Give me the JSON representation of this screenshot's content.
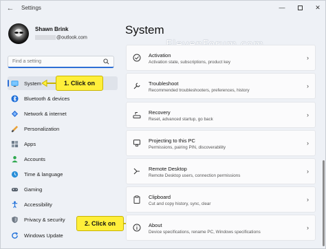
{
  "window": {
    "title": "Settings",
    "back_glyph": "←",
    "minimize_glyph": "—",
    "close_glyph": "✕"
  },
  "profile": {
    "name": "Shawn Brink",
    "email_visible": "@outlook.com"
  },
  "search": {
    "placeholder": "Find a setting"
  },
  "sidebar": {
    "items": [
      {
        "label": "System",
        "icon": "monitor-icon",
        "active": true
      },
      {
        "label": "Bluetooth & devices",
        "icon": "bluetooth-icon"
      },
      {
        "label": "Network & internet",
        "icon": "wifi-diamond-icon"
      },
      {
        "label": "Personalization",
        "icon": "brush-icon"
      },
      {
        "label": "Apps",
        "icon": "apps-icon"
      },
      {
        "label": "Accounts",
        "icon": "person-icon"
      },
      {
        "label": "Time & language",
        "icon": "globe-clock-icon"
      },
      {
        "label": "Gaming",
        "icon": "gamepad-icon"
      },
      {
        "label": "Accessibility",
        "icon": "accessibility-icon"
      },
      {
        "label": "Privacy & security",
        "icon": "shield-icon"
      },
      {
        "label": "Windows Update",
        "icon": "update-icon"
      }
    ]
  },
  "callouts": {
    "first": "1. Click on",
    "second": "2. Click on"
  },
  "main": {
    "title": "System",
    "watermark": "ElevenForum.com",
    "cards": [
      {
        "title": "Activation",
        "subtitle": "Activation state, subscriptions, product key",
        "icon": "check-circle-icon"
      },
      {
        "title": "Troubleshoot",
        "subtitle": "Recommended troubleshooters, preferences, history",
        "icon": "wrench-icon"
      },
      {
        "title": "Recovery",
        "subtitle": "Reset, advanced startup, go back",
        "icon": "recovery-drive-icon"
      },
      {
        "title": "Projecting to this PC",
        "subtitle": "Permissions, pairing PIN, discoverability",
        "icon": "projector-icon"
      },
      {
        "title": "Remote Desktop",
        "subtitle": "Remote Desktop users, connection permissions",
        "icon": "remote-desktop-icon"
      },
      {
        "title": "Clipboard",
        "subtitle": "Cut and copy history, sync, clear",
        "icon": "clipboard-icon"
      },
      {
        "title": "About",
        "subtitle": "Device specifications, rename PC, Windows specifications",
        "icon": "info-icon"
      }
    ],
    "chevron": "›"
  },
  "colors": {
    "accent": "#2c6ed5",
    "callout": "#ffef3a",
    "background": "#eef1f6"
  }
}
